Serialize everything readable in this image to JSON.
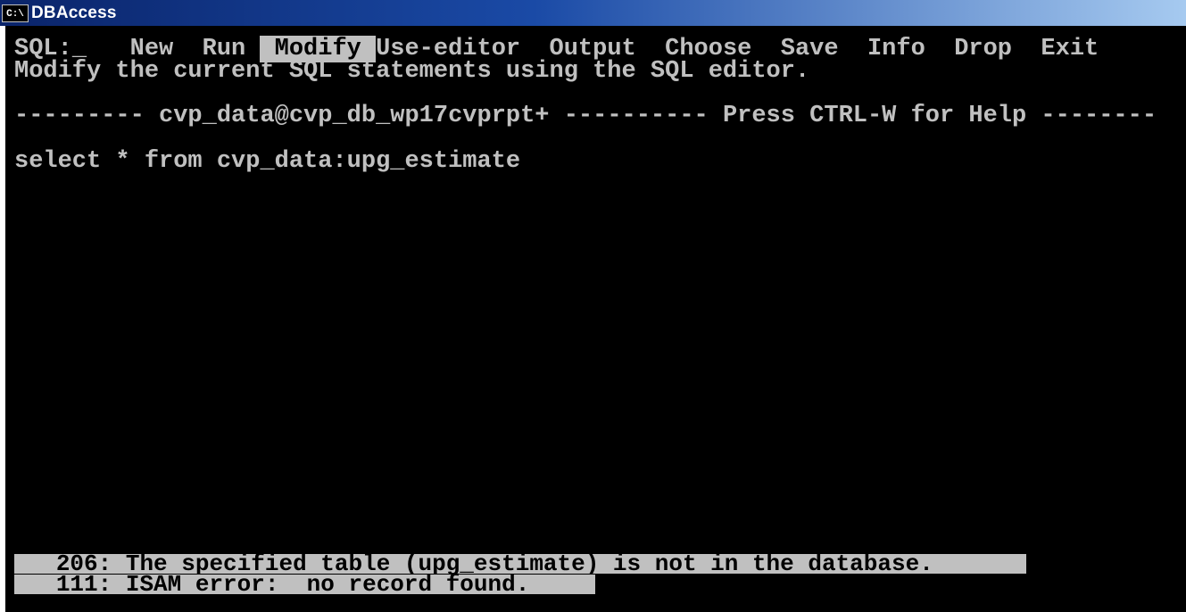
{
  "window": {
    "icon_label": "C:\\",
    "title": "DBAccess"
  },
  "menu": {
    "prompt": "SQL:",
    "cursor": "_",
    "items": [
      {
        "label": "New"
      },
      {
        "label": "Run"
      },
      {
        "label": "Modify",
        "selected": true
      },
      {
        "label": "Use-editor"
      },
      {
        "label": "Output"
      },
      {
        "label": "Choose"
      },
      {
        "label": "Save"
      },
      {
        "label": "Info"
      },
      {
        "label": "Drop"
      },
      {
        "label": "Exit"
      }
    ],
    "description": "Modify the current SQL statements using the SQL editor."
  },
  "status_line": {
    "left_dashes": "---------",
    "database": "cvp_data@cvp_db_wp17cvprpt+",
    "mid_dashes": "----------",
    "help": "Press CTRL-W for Help",
    "right_dashes": "--------"
  },
  "editor": {
    "sql": "select * from cvp_data:upg_estimate"
  },
  "errors": [
    {
      "code": "206:",
      "message": "The specified table (upg_estimate) is not in the database."
    },
    {
      "code": "111:",
      "message": "ISAM error:  no record found."
    }
  ],
  "colors": {
    "console_bg": "#000000",
    "console_fg": "#c0c0c0",
    "highlight_bg": "#c0c0c0",
    "title_bar": "#0a246a"
  }
}
